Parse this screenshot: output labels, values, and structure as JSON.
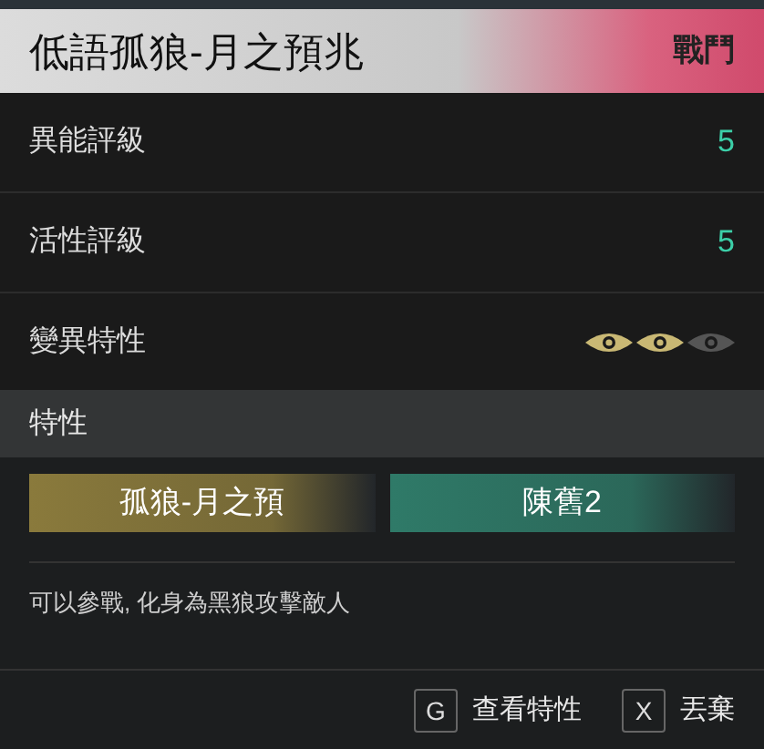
{
  "header": {
    "title": "低語孤狼-月之預兆",
    "tag": "戰鬥"
  },
  "stats": [
    {
      "label": "異能評級",
      "value": "5"
    },
    {
      "label": "活性評級",
      "value": "5"
    }
  ],
  "mutation": {
    "label": "變異特性",
    "eyes": [
      {
        "on": true
      },
      {
        "on": true
      },
      {
        "on": false
      }
    ]
  },
  "traits_section": {
    "title": "特性"
  },
  "traits": [
    {
      "label": "孤狼-月之預",
      "color": "#8a7a3c"
    },
    {
      "label": "陳舊2",
      "color": "#2f7a68"
    }
  ],
  "description": "可以參戰, 化身為黑狼攻擊敵人",
  "actions": [
    {
      "key": "G",
      "label": "查看特性"
    },
    {
      "key": "X",
      "label": "丟棄"
    }
  ]
}
